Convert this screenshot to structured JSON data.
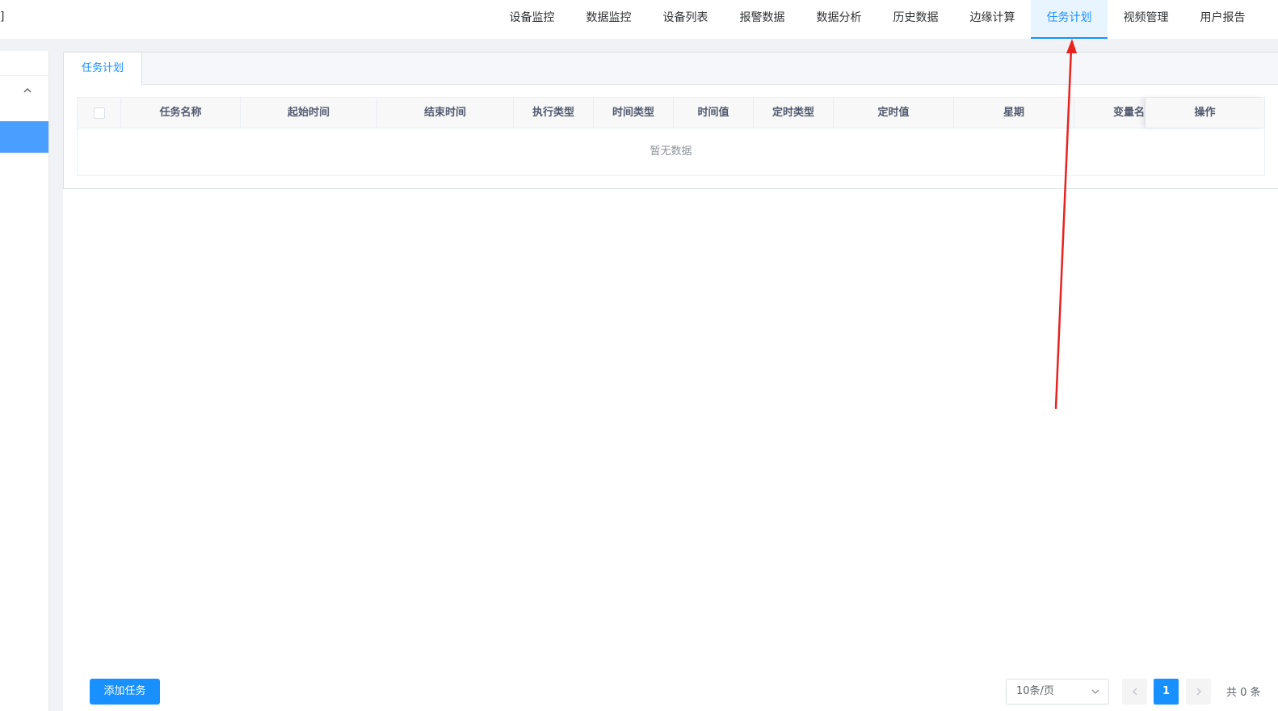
{
  "header": {
    "brand_fragment": "]",
    "nav": [
      {
        "label": "设备监控"
      },
      {
        "label": "数据监控"
      },
      {
        "label": "设备列表"
      },
      {
        "label": "报警数据"
      },
      {
        "label": "数据分析"
      },
      {
        "label": "历史数据"
      },
      {
        "label": "边缘计算"
      },
      {
        "label": "任务计划",
        "active": true
      },
      {
        "label": "视频管理"
      },
      {
        "label": "用户报告"
      }
    ]
  },
  "tabs": [
    {
      "label": "任务计划"
    }
  ],
  "table": {
    "columns": [
      "任务名称",
      "起始时间",
      "结束时间",
      "执行类型",
      "时间类型",
      "时间值",
      "定时类型",
      "定时值",
      "星期",
      "变量名",
      "操作"
    ],
    "empty_text": "暂无数据"
  },
  "footer": {
    "add_label": "添加任务",
    "page_size": "10条/页",
    "current_page": "1",
    "total": "共 0 条"
  },
  "colors": {
    "accent": "#1890ff",
    "annotation": "#e8231f"
  },
  "icons": [
    "chevron-up-icon",
    "chevron-down-icon",
    "chevron-left-icon",
    "chevron-right-icon"
  ]
}
